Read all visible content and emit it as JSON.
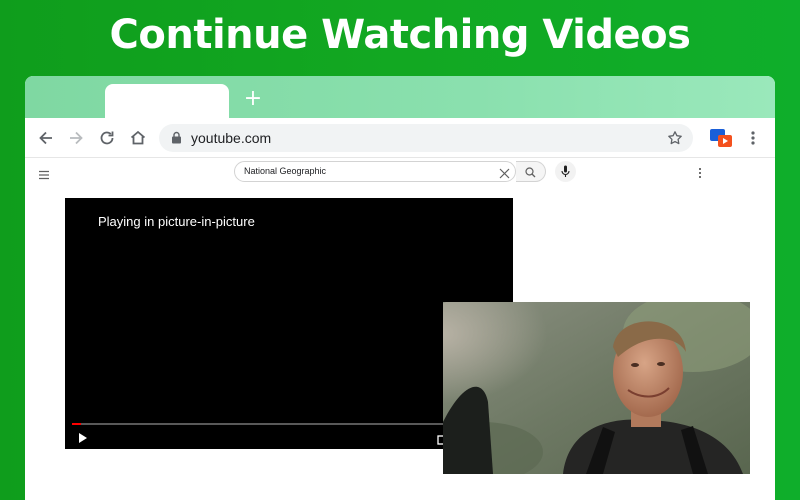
{
  "headline": "Continue Watching Videos",
  "browser": {
    "new_tab_glyph": "+",
    "omnibox": {
      "url": "youtube.com",
      "icon": "lock-icon",
      "bookmark_icon": "star-icon"
    },
    "nav_icons": [
      "back-arrow-icon",
      "forward-arrow-icon",
      "reload-icon",
      "home-icon"
    ],
    "extension_icon": "pip-extension-icon",
    "menu_icon": "kebab-menu-icon"
  },
  "youtube": {
    "search_value": "National Geographic",
    "player": {
      "message": "Playing in picture-in-picture",
      "progress": 0.02
    }
  },
  "colors": {
    "background_green": "#12a822",
    "tabstrip": "#8ae0ae",
    "progress_red": "#ff0000"
  }
}
